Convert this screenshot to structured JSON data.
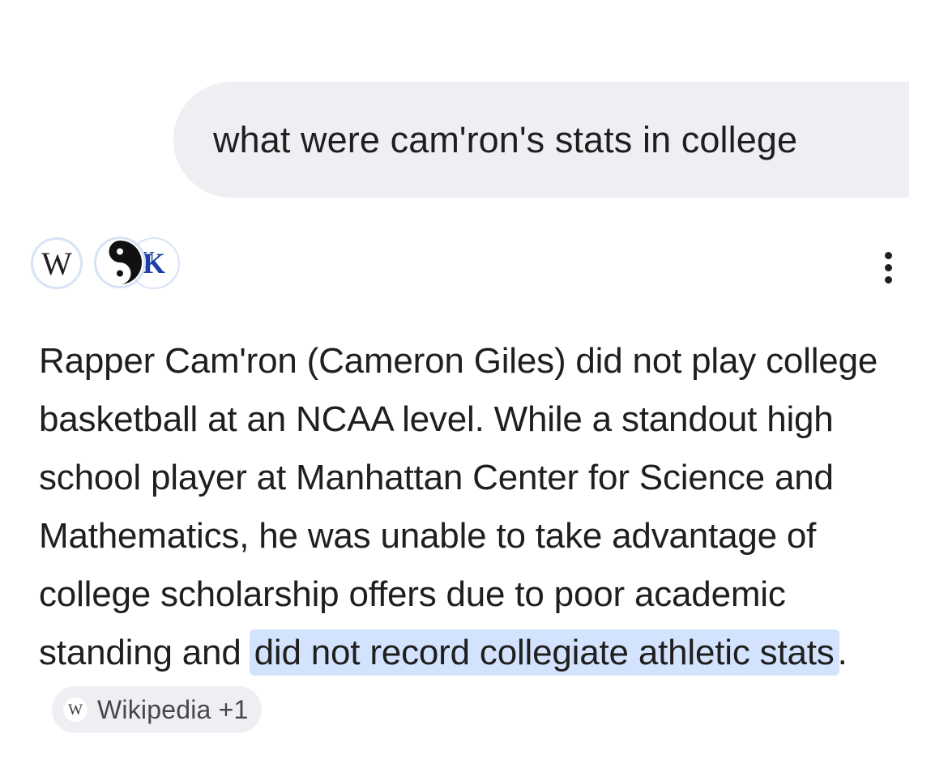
{
  "query": {
    "text": "what were cam'ron's stats in college"
  },
  "sources": {
    "icons": [
      {
        "name": "wikipedia-icon",
        "letter": "W"
      },
      {
        "name": "yin-yang-icon"
      },
      {
        "name": "kentucky-uk-icon",
        "color": "#1c3fa8"
      }
    ]
  },
  "menu": {
    "icon": "more-vert-icon"
  },
  "answer": {
    "text_plain": "Rapper Cam'ron (Cameron Giles) did not play college basketball at an NCAA level. While a standout high school player at Manhattan Center for Science and Mathematics, he was unable to take advantage of college scholarship offers due to poor academic standing and ",
    "text_highlight": "did not record collegiate athletic stats",
    "text_end": ".",
    "highlight_color": "#d3e3fd"
  },
  "citation_chip": {
    "icon_letter": "W",
    "label": "Wikipedia +1"
  },
  "colors": {
    "bubble_bg": "#eeeff3",
    "text": "#1f1f1f",
    "chip_text": "#474747"
  }
}
